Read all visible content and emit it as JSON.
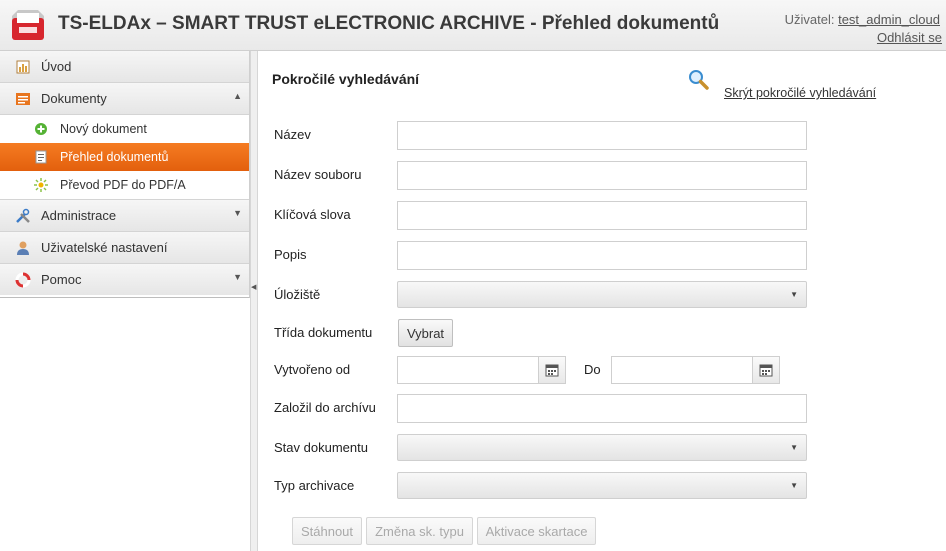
{
  "header": {
    "title": "TS-ELDAx – SMART TRUST eLECTRONIC ARCHIVE - Přehled dokumentů",
    "user_label": "Uživatel:",
    "user_name": "test_admin_cloud",
    "logout": "Odhlásit se"
  },
  "sidebar": {
    "items": [
      {
        "label": "Úvod",
        "icon": "home-icon"
      },
      {
        "label": "Dokumenty",
        "icon": "documents-icon",
        "arrow": "▲"
      },
      {
        "label": "Administrace",
        "icon": "tools-icon",
        "arrow": "▼"
      },
      {
        "label": "Uživatelské nastavení",
        "icon": "user-icon"
      },
      {
        "label": "Pomoc",
        "icon": "lifebuoy-icon",
        "arrow": "▼"
      }
    ],
    "subitems": [
      {
        "label": "Nový dokument",
        "icon": "add-icon"
      },
      {
        "label": "Přehled dokumentů",
        "icon": "document-list-icon",
        "active": true
      },
      {
        "label": "Převod PDF do PDF/A",
        "icon": "convert-icon"
      }
    ]
  },
  "search": {
    "title": "Pokročilé vyhledávání",
    "hide_link": "Skrýt pokročilé vyhledávání",
    "fields": {
      "name": {
        "label": "Název",
        "value": ""
      },
      "filename": {
        "label": "Název souboru",
        "value": ""
      },
      "keywords": {
        "label": "Klíčová slova",
        "value": ""
      },
      "description": {
        "label": "Popis",
        "value": ""
      },
      "storage": {
        "label": "Úložiště",
        "value": ""
      },
      "doc_class": {
        "label": "Třída dokumentu",
        "button": "Vybrat"
      },
      "created_from": {
        "label": "Vytvořeno od",
        "value": ""
      },
      "created_to": {
        "label": "Do",
        "value": ""
      },
      "archived_by": {
        "label": "Založil do archívu",
        "value": ""
      },
      "doc_state": {
        "label": "Stav dokumentu",
        "value": ""
      },
      "archive_type": {
        "label": "Typ archivace",
        "value": ""
      }
    }
  },
  "actions": {
    "download": "Stáhnout",
    "change_type": "Změna sk. typu",
    "activate_shredding": "Aktivace skartace"
  },
  "colors": {
    "accent": "#f26e1a",
    "header_bg": "#eeeeee"
  }
}
